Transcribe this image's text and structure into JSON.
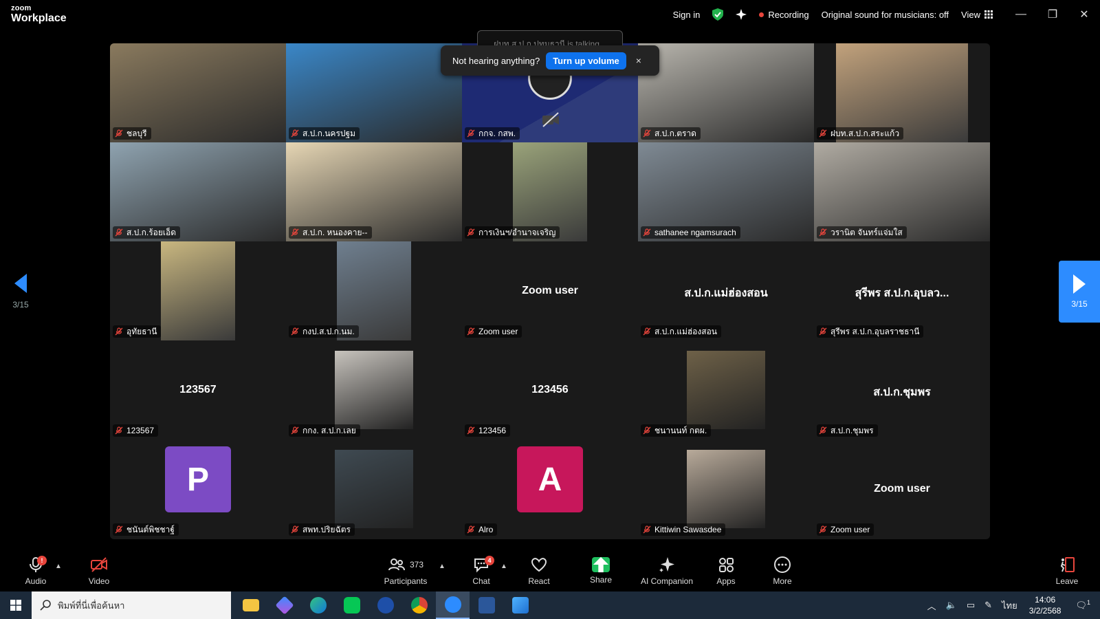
{
  "app": {
    "brand_line1": "zoom",
    "brand_line2": "Workplace"
  },
  "titlebar": {
    "sign_in": "Sign in",
    "recording": "Recording",
    "original_sound": "Original sound for musicians: off",
    "view": "View",
    "icons": [
      "shield-check-icon",
      "sparkle-icon",
      "grid-icon",
      "minimize-icon",
      "restore-icon",
      "close-icon"
    ]
  },
  "toast": {
    "talking_text": "ฝบท.ส.ป.ก.ปทุมธานี is talking...",
    "message": "Not hearing anything?",
    "button": "Turn up volume",
    "close": "×"
  },
  "pagination": {
    "left_page": "3/15",
    "right_page": "3/15"
  },
  "tiles": [
    {
      "name": "ชลบุรี",
      "display": "",
      "kind": "video",
      "color": "#8a7a5e"
    },
    {
      "name": "ส.ป.ก.นครปฐม",
      "display": "",
      "kind": "video",
      "color": "#3a87c8"
    },
    {
      "name": "กกจ. กสพ.",
      "display": "",
      "kind": "video-off",
      "color": "#1e2a73"
    },
    {
      "name": "ส.ป.ก.ตราด",
      "display": "",
      "kind": "video",
      "color": "#b9b6ae"
    },
    {
      "name": "ฝบท.ส.ป.ก.สระแก้ว",
      "display": "",
      "kind": "video-narrow",
      "color": "#c2a27c"
    },
    {
      "name": "ส.ป.ก.ร้อยเอ็ด",
      "display": "",
      "kind": "video",
      "color": "#8fa3b0"
    },
    {
      "name": "ส.ป.ก. หนองคาย--",
      "display": "",
      "kind": "video",
      "color": "#e6d6b4"
    },
    {
      "name": "การเงินฯ/อำนาจเจริญ",
      "display": "",
      "kind": "video-narrow",
      "color": "#9aa37a"
    },
    {
      "name": "sathanee ngamsurach",
      "display": "",
      "kind": "video",
      "color": "#7f8a94"
    },
    {
      "name": "วรานิต จันทร์แจ่มใส",
      "display": "",
      "kind": "video",
      "color": "#b0aba2"
    },
    {
      "name": "อุทัยธานี",
      "display": "",
      "kind": "video-narrow",
      "color": "#c9b780"
    },
    {
      "name": "กงป.ส.ป.ก.นม.",
      "display": "",
      "kind": "video-narrow",
      "color": "#6f7f8f"
    },
    {
      "name": "Zoom user",
      "display": "Zoom user",
      "kind": "name",
      "color": ""
    },
    {
      "name": "ส.ป.ก.แม่ฮ่องสอน",
      "display": "ส.ป.ก.แม่ฮ่องสอน",
      "kind": "name",
      "color": ""
    },
    {
      "name": "สุรีพร ส.ป.ก.อุบลราชธานี",
      "display": "สุรีพร ส.ป.ก.อุบลว...",
      "kind": "name",
      "color": ""
    },
    {
      "name": "123567",
      "display": "123567",
      "kind": "name",
      "color": ""
    },
    {
      "name": "กกง. ส.ป.ก.เลย",
      "display": "",
      "kind": "photo",
      "color": "#c7c3bd"
    },
    {
      "name": "123456",
      "display": "123456",
      "kind": "name",
      "color": ""
    },
    {
      "name": "ชนานนท์ กตผ.",
      "display": "",
      "kind": "photo",
      "color": "#6e6148"
    },
    {
      "name": "ส.ป.ก.ชุมพร",
      "display": "ส.ป.ก.ชุมพร",
      "kind": "name",
      "color": ""
    },
    {
      "name": "ชนันต์พิชชาฐ์",
      "display": "P",
      "kind": "avatar",
      "color": "#7c4bc4"
    },
    {
      "name": "สพท.ปริยฉัตร",
      "display": "",
      "kind": "photo",
      "color": "#3f4a52"
    },
    {
      "name": "Alro",
      "display": "A",
      "kind": "avatar",
      "color": "#c7175b"
    },
    {
      "name": "Kittiwin Sawasdee",
      "display": "",
      "kind": "photo",
      "color": "#b8aa9a"
    },
    {
      "name": "Zoom user",
      "display": "Zoom user",
      "kind": "name",
      "color": ""
    }
  ],
  "toolbar": {
    "audio": "Audio",
    "video": "Video",
    "participants": "Participants",
    "participants_count": "373",
    "chat": "Chat",
    "chat_badge": "4",
    "react": "React",
    "share": "Share",
    "ai_companion": "AI Companion",
    "apps": "Apps",
    "more": "More",
    "leave": "Leave"
  },
  "taskbar": {
    "search_placeholder": "พิมพ์ที่นี่เพื่อค้นหา",
    "lang": "ไทย",
    "time": "14:06",
    "date": "3/2/2568",
    "notifications": "1",
    "apps": [
      "file-explorer-icon",
      "copilot-icon",
      "edge-icon",
      "line-icon",
      "word-alt-icon",
      "chrome-icon",
      "zoom-icon",
      "word-icon",
      "photos-icon"
    ]
  },
  "colors": {
    "accent": "#0e72ed",
    "nav_blue": "#2d8cff",
    "recording": "#e8453c",
    "share_green": "#1fbf5f",
    "tile_bg": "#1a1a1a"
  }
}
